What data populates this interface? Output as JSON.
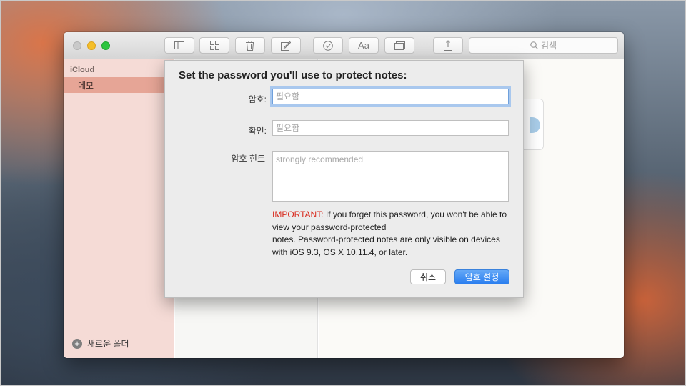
{
  "toolbar": {
    "buttons": [
      "sidebar-toggle",
      "attachments",
      "delete",
      "compose",
      "checklist",
      "format",
      "table",
      "share"
    ],
    "format_label": "Aa",
    "search_placeholder": "검색"
  },
  "sidebar": {
    "header": "iCloud",
    "items": [
      {
        "label": "메모",
        "selected": true
      }
    ],
    "new_folder_label": "새로운 폴더"
  },
  "dialog": {
    "title": "Set the password you'll use to protect notes:",
    "password_label": "암호:",
    "password_placeholder": "필요함",
    "verify_label": "확인:",
    "verify_placeholder": "필요함",
    "hint_label": "암호 힌트",
    "hint_placeholder": "strongly recommended",
    "important_prefix": "IMPORTANT:",
    "important_line1": " If you forget this password, you won't be able to view your password-protected",
    "important_line2": "notes. Password-protected notes are only visible on devices with iOS 9.3, OS X 10.11.4, or later.",
    "cancel_label": "취소",
    "confirm_label": "암호 설정"
  },
  "colors": {
    "accent": "#2a7eef",
    "sidebar_bg": "#f5dbd6",
    "sidebar_selected": "#e6a596",
    "important": "#d8291c"
  }
}
